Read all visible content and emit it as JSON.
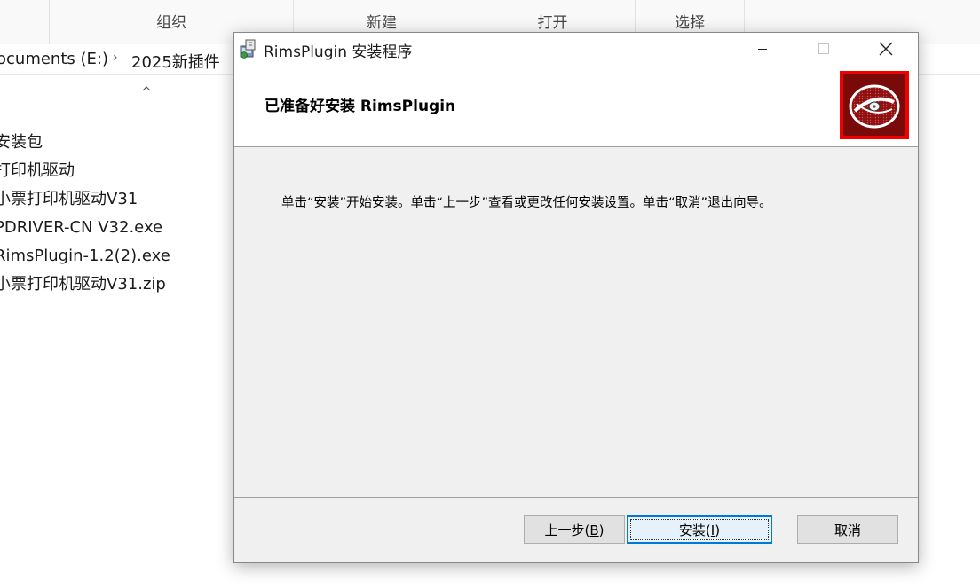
{
  "explorer": {
    "ribbon_groups": [
      "组织",
      "新建",
      "打开",
      "选择"
    ],
    "breadcrumb": [
      "ocuments (E:)",
      "2025新插件"
    ],
    "files": [
      "安装包",
      "打印机驱动",
      "小票打印机驱动V31",
      "PDRIVER-CN V32.exe",
      "RimsPlugin-1.2(2).exe",
      "小票打印机驱动V31.zip"
    ]
  },
  "dialog": {
    "title": "RimsPlugin 安装程序",
    "header_title": "已准备好安装 RimsPlugin",
    "body_text": "单击“安装”开始安装。单击“上一步”查看或更改任何安装设置。单击“取消”退出向导。",
    "buttons": {
      "back": "上一步",
      "back_mnemonic": "B",
      "install": "安装",
      "install_mnemonic": "I",
      "cancel": "取消"
    },
    "icons": {
      "title": "installer-icon",
      "logo": "disc-logo-icon",
      "minimize": "minimize-icon",
      "maximize": "maximize-icon",
      "close": "close-icon"
    },
    "colors": {
      "logo_border": "#f20000",
      "logo_background": "#7a0a0a",
      "default_button_border": "#0078d7"
    }
  }
}
